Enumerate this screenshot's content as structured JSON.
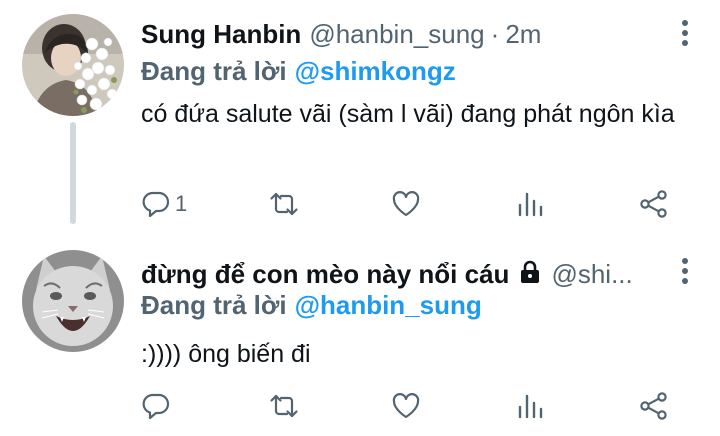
{
  "tweets": [
    {
      "author_name": "Sung Hanbin",
      "handle": "@hanbin_sung",
      "separator": "·",
      "time": "2m",
      "reply_lead": "Đang trả lời",
      "reply_to": "@shimkongz",
      "text": "có đứa salute vãi (sàm l vãi) đang phát ngôn kìa",
      "reply_count": "1",
      "avatar_icon": "person-with-flowers-avatar",
      "protected": false
    },
    {
      "author_name": "đừng để con mèo này nổi cáu",
      "handle": "@shi...",
      "reply_lead": "Đang trả lời",
      "reply_to": "@hanbin_sung",
      "text": ":)))) ông biến đi",
      "reply_count": "",
      "avatar_icon": "cat-avatar",
      "protected": true
    }
  ],
  "icons": {
    "reply": "reply-icon",
    "retweet": "retweet-icon",
    "like": "heart-icon",
    "stats": "stats-icon",
    "share": "share-icon",
    "more": "more-vertical-icon",
    "lock": "lock-icon"
  },
  "colors": {
    "link": "#1d9bf0",
    "secondary": "#536471",
    "text": "#0f1419",
    "thread_line": "#cfd9de"
  }
}
